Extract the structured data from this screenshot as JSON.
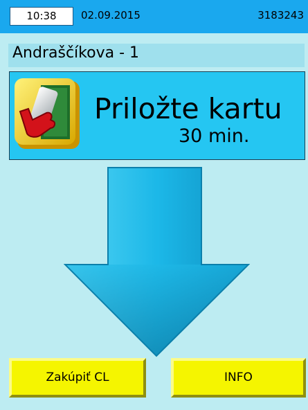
{
  "status_bar": {
    "time": "10:38",
    "date": "02.09.2015",
    "device_id": "3183243"
  },
  "stop": {
    "name": "Andraščíkova - 1"
  },
  "message": {
    "title": "Priložte kartu",
    "duration": "30 min.",
    "icon": "card-tap-icon"
  },
  "arrow": {
    "icon": "down-arrow-icon",
    "color": "#1fb8e6"
  },
  "buttons": {
    "buy_label": "Zakúpiť CL",
    "info_label": "INFO"
  },
  "colors": {
    "background": "#bdecf2",
    "top_bar": "#1aa8ee",
    "panel": "#25c6f2",
    "button": "#f5f500"
  }
}
